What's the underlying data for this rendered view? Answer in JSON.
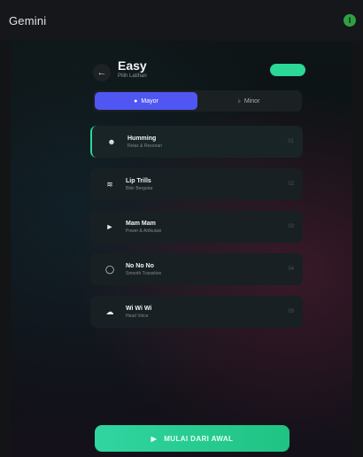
{
  "app": {
    "title": "Gemini",
    "avatar_letter": "I"
  },
  "exercise": {
    "title": "Easy",
    "subtitle": "Pilih Latihan",
    "back_icon": "arrow-left-icon"
  },
  "scale_toggle": {
    "options": [
      {
        "label": "Mayor",
        "icon": "dot-icon",
        "active": true
      },
      {
        "label": "Minor",
        "icon": "flat-icon",
        "active": false
      }
    ]
  },
  "exercises": [
    {
      "title": "Humming",
      "subtitle": "Relax & Resonan",
      "number": "01",
      "icon": "smile-icon",
      "active": true
    },
    {
      "title": "Lip Trills",
      "subtitle": "Bibir Bergetar",
      "number": "02",
      "icon": "wind-icon",
      "active": false
    },
    {
      "title": "Mam Mam",
      "subtitle": "Power & Artikulasi",
      "number": "03",
      "icon": "megaphone-icon",
      "active": false
    },
    {
      "title": "No No No",
      "subtitle": "Smooth Transition",
      "number": "04",
      "icon": "circle-icon",
      "active": false
    },
    {
      "title": "Wi Wi Wi",
      "subtitle": "Head Voice",
      "number": "05",
      "icon": "cloud-icon",
      "active": false
    }
  ],
  "cta": {
    "label": "MULAI DARI AWAL",
    "icon": "play-icon"
  },
  "colors": {
    "accent": "#2bd896",
    "segment_active": "#4f56f1",
    "cta": "#2bcf94"
  }
}
